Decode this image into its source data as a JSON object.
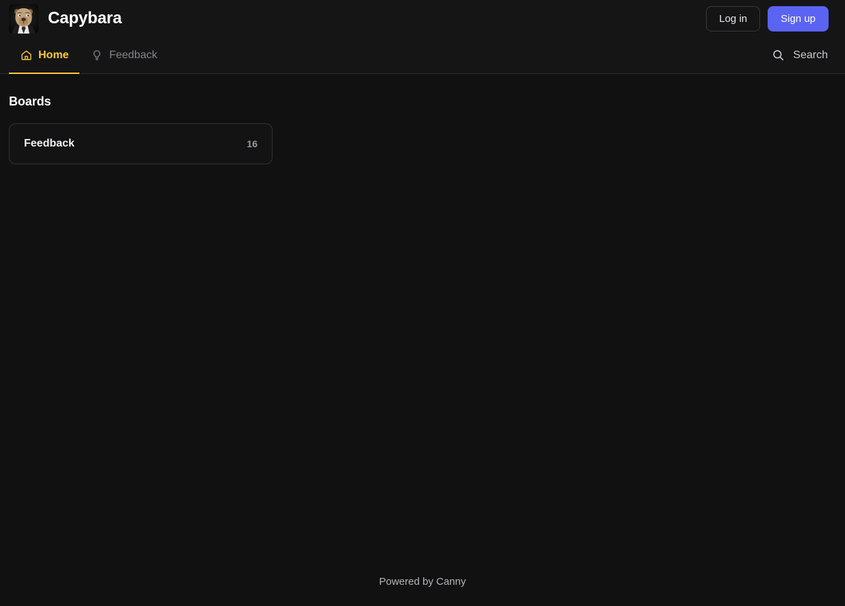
{
  "header": {
    "brand_name": "Capybara",
    "avatar_icon": "capybara-avatar",
    "login_label": "Log in",
    "signup_label": "Sign up"
  },
  "nav": {
    "tabs": [
      {
        "label": "Home",
        "icon": "home-icon",
        "active": true
      },
      {
        "label": "Feedback",
        "icon": "lightbulb-icon",
        "active": false
      }
    ],
    "search_label": "Search",
    "search_icon": "search-icon"
  },
  "main": {
    "section_title": "Boards",
    "boards": [
      {
        "name": "Feedback",
        "count": "16"
      }
    ]
  },
  "footer": {
    "powered_by": "Powered by Canny"
  },
  "colors": {
    "page_background": "#111112",
    "header_background": "#151516",
    "accent_active": "#fdc93b",
    "signup_button": "#5b63f2",
    "border": "#2b2b2e",
    "card_border": "#333336"
  }
}
